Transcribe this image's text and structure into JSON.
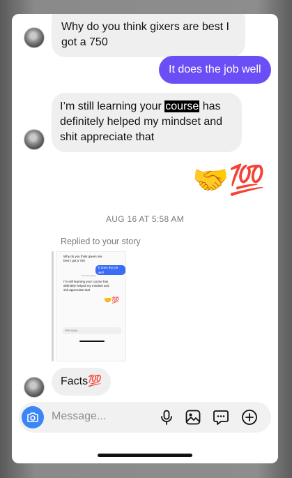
{
  "messages": {
    "m1": "Why do you think gixers are best I got a 750",
    "m2": "It does the job well",
    "m3_before": "I’m still learning your ",
    "m3_highlight": "course",
    "m3_after": " has definitely helped my mindset and shit appreciate that",
    "m4_emoji": "🤝💯",
    "m5": "Facts💯"
  },
  "date_separator": "AUG 16 AT 5:58 AM",
  "story_reply": {
    "label": "Replied to your story",
    "mini_m1": "Why do you think gixers are best I got a 750",
    "mini_m2": "It does the job well",
    "mini_new": "New Messages",
    "mini_m3": "I’m still learning your course has definitely helped my mindset and shit appreciate that",
    "mini_emoji": "🤝💯",
    "mini_placeholder": "Message..."
  },
  "composer": {
    "placeholder": "Message..."
  },
  "colors": {
    "my_bubble": "#6b4ef6",
    "their_bubble": "#efefef",
    "camera": "#3b86f7"
  },
  "icons": [
    "camera-icon",
    "microphone-icon",
    "image-icon",
    "sticker-icon",
    "plus-icon"
  ]
}
